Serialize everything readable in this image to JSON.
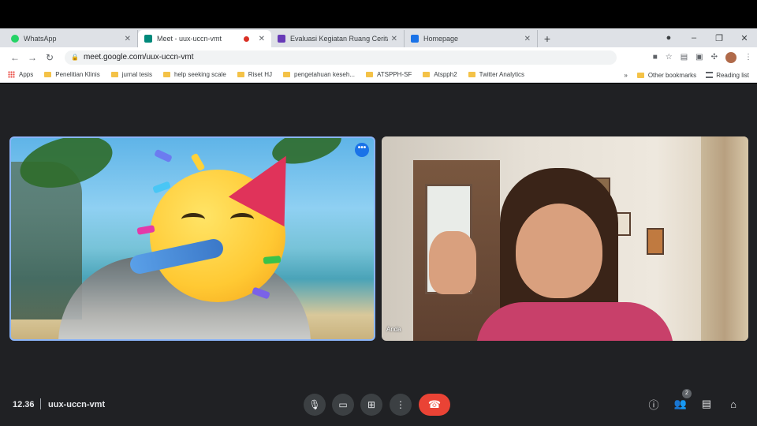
{
  "browser": {
    "tabs": [
      {
        "title": "WhatsApp",
        "color": "#25d366"
      },
      {
        "title": "Meet - uux-uccn-vmt",
        "color": "#00897b"
      },
      {
        "title": "Evaluasi Kegiatan Ruang Cerita",
        "color": "#673ab7"
      },
      {
        "title": "Homepage",
        "color": "#1a73e8"
      }
    ],
    "new_tab": "+",
    "url": "meet.google.com/uux-uccn-vmt",
    "window_controls": {
      "minimize": "–",
      "restore": "❐",
      "close": "✕"
    }
  },
  "bookmarks": {
    "items": [
      "Apps",
      "Penelitian Klinis",
      "jurnal tesis",
      "help seeking scale",
      "Riset HJ",
      "pengetahuan keseh...",
      "ATSPPH-SF",
      "Atspph2",
      "Twitter Analytics"
    ],
    "overflow": "»",
    "other": "Other bookmarks",
    "reading_list": "Reading list"
  },
  "meet": {
    "participants": [
      {
        "name": "",
        "menu": "•••"
      },
      {
        "name": "Anda"
      }
    ],
    "clock": "12.36",
    "meeting_code": "uux-uccn-vmt",
    "participant_count": "2",
    "accent": "#8ab4f8",
    "end_call_color": "#ea4335"
  }
}
